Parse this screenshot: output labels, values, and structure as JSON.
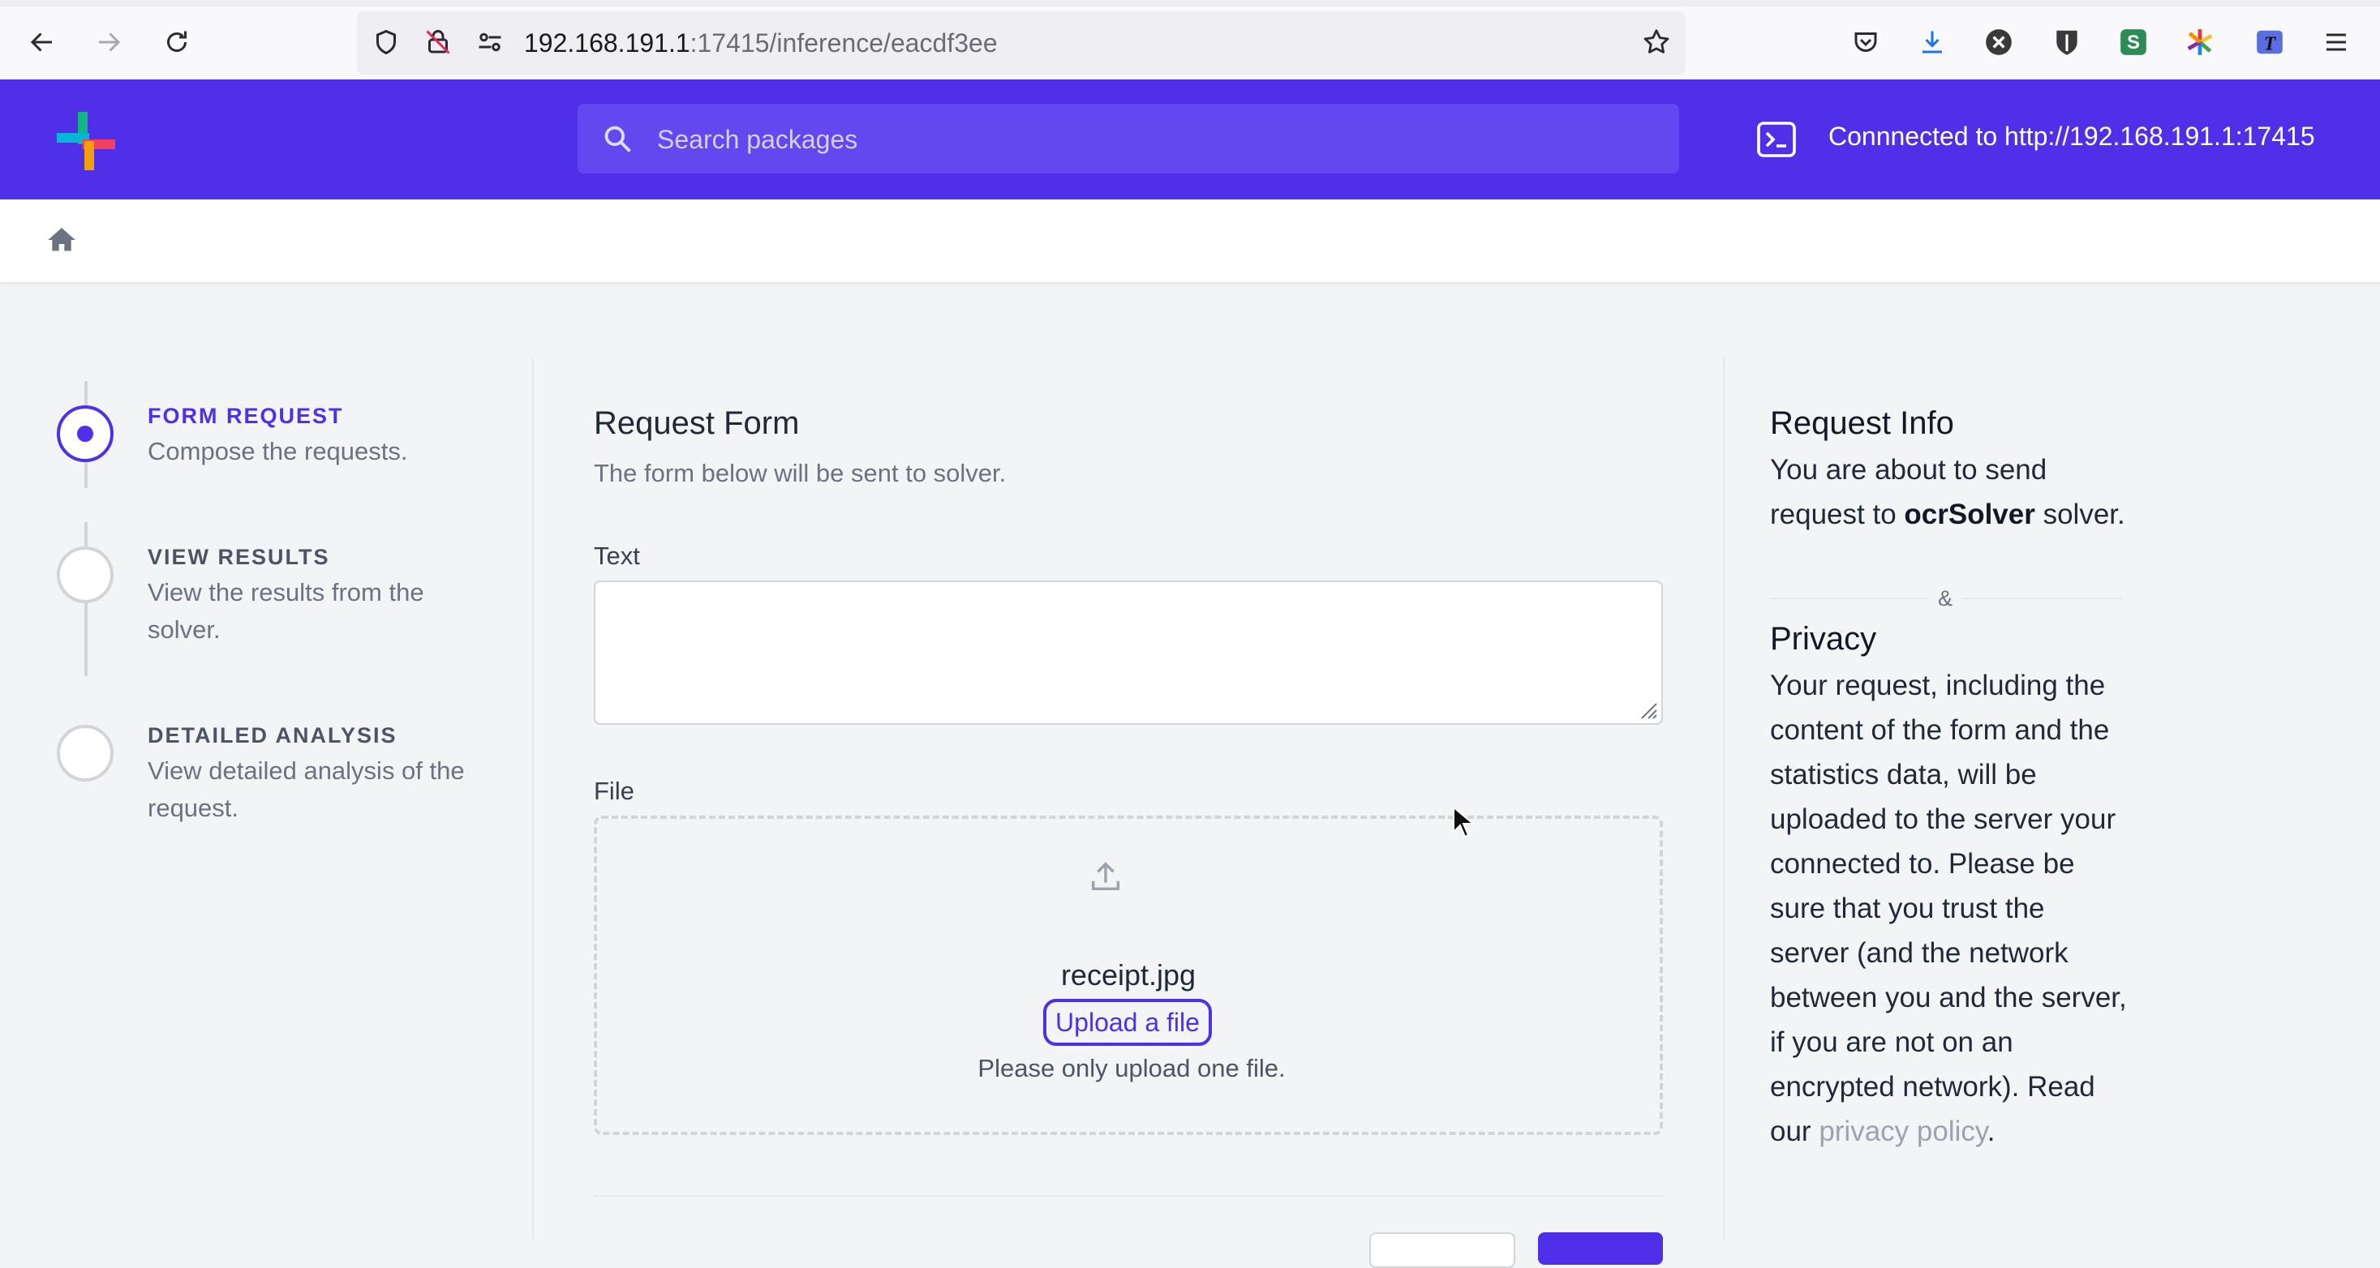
{
  "browser": {
    "url_host": "192.168.191.1",
    "url_path": ":17415/inference/eacdf3ee"
  },
  "header": {
    "search_placeholder": "Search packages",
    "connection_status": "Connnected to http://192.168.191.1:17415"
  },
  "steps": [
    {
      "title": "FORM REQUEST",
      "description": "Compose the requests.",
      "active": true
    },
    {
      "title": "VIEW RESULTS",
      "description": "View the results from the solver.",
      "active": false
    },
    {
      "title": "DETAILED ANALYSIS",
      "description": "View detailed analysis of the request.",
      "active": false
    }
  ],
  "form": {
    "title": "Request Form",
    "subtitle": "The form below will be sent to solver.",
    "text_label": "Text",
    "text_value": "",
    "file_label": "File",
    "file_name": "receipt.jpg",
    "upload_button": "Upload a file",
    "upload_hint": "Please only upload one file."
  },
  "info": {
    "request_title": "Request Info",
    "request_text_before": "You are about to send request to ",
    "solver_name": "ocrSolver",
    "request_text_after": " solver.",
    "separator": "&",
    "privacy_title": "Privacy",
    "privacy_text": "Your request, including the content of the form and the statistics data, will be uploaded to the server your connected to. Please be sure that you trust the server (and the network between you and the server, if you are not on an encrypted network). Read our ",
    "privacy_link": "privacy policy",
    "privacy_end": "."
  },
  "colors": {
    "brand": "#4f2fe8",
    "page_bg": "#f3f4f6"
  }
}
